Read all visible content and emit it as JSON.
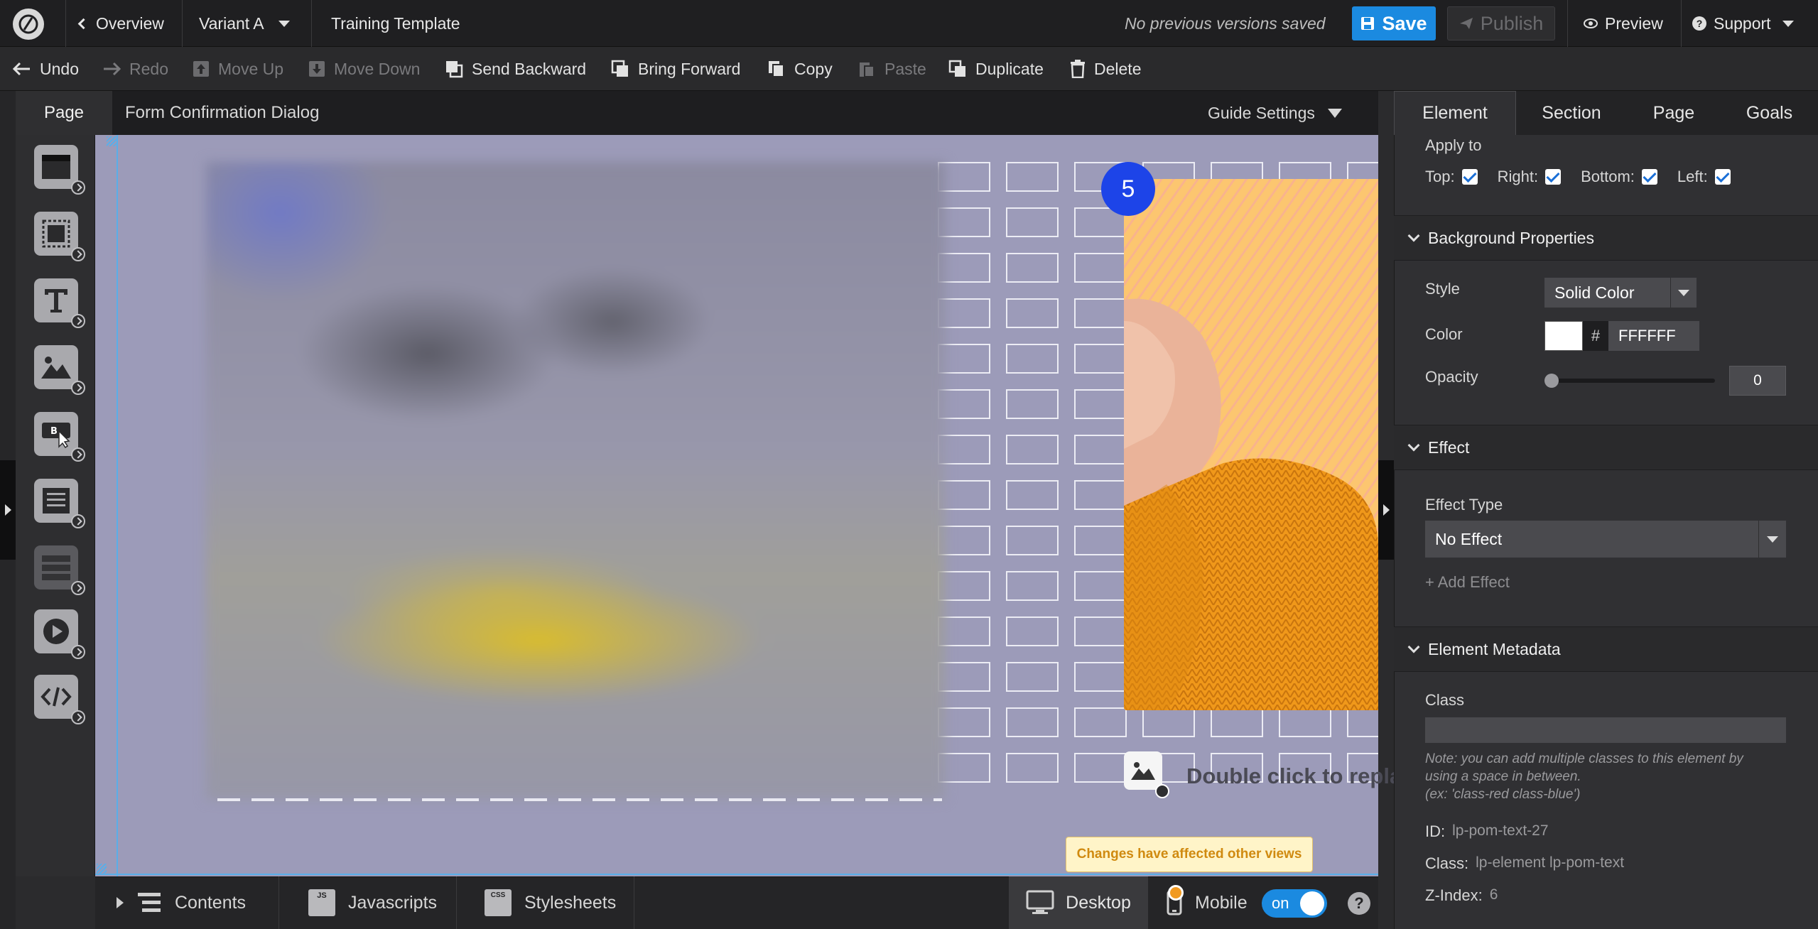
{
  "topbar": {
    "overview": "Overview",
    "variant": "Variant A",
    "template_name": "Training Template",
    "versions_status": "No previous versions saved",
    "save_label": "Save",
    "publish_label": "Publish",
    "preview_label": "Preview",
    "support_label": "Support"
  },
  "toolbar": {
    "undo": "Undo",
    "redo": "Redo",
    "move_up": "Move Up",
    "move_down": "Move Down",
    "send_backward": "Send Backward",
    "bring_forward": "Bring Forward",
    "copy": "Copy",
    "paste": "Paste",
    "duplicate": "Duplicate",
    "delete": "Delete"
  },
  "page_header": {
    "tab": "Page",
    "name": "Form Confirmation Dialog",
    "guide_settings": "Guide Settings"
  },
  "canvas": {
    "badge_number": "5",
    "replace_hint": "Double click to repla"
  },
  "right_panel": {
    "tabs": [
      "Element",
      "Section",
      "Page",
      "Goals"
    ],
    "apply_to": {
      "label": "Apply to",
      "top": "Top:",
      "right": "Right:",
      "bottom": "Bottom:",
      "left": "Left:"
    },
    "background": {
      "title": "Background Properties",
      "style_label": "Style",
      "style_value": "Solid Color",
      "color_label": "Color",
      "color_hash": "#",
      "color_value": "FFFFFF",
      "opacity_label": "Opacity",
      "opacity_value": "0"
    },
    "effect": {
      "title": "Effect",
      "type_label": "Effect Type",
      "type_value": "No Effect",
      "add_effect": "+ Add Effect"
    },
    "metadata": {
      "title": "Element Metadata",
      "class_label": "Class",
      "note_line1": "Note: you can add multiple classes to this element by",
      "note_line2": "using a space in between.",
      "note_line3": "(ex: 'class-red class-blue')",
      "id_label": "ID:",
      "id_value": "lp-pom-text-27",
      "class_info_label": "Class:",
      "class_info_value": "lp-element lp-pom-text",
      "zindex_label": "Z-Index:",
      "zindex_value": "6"
    }
  },
  "bottombar": {
    "contents": "Contents",
    "javascripts": "Javascripts",
    "stylesheets": "Stylesheets",
    "js_badge": "JS",
    "css_badge": "CSS",
    "desktop": "Desktop",
    "mobile": "Mobile",
    "toggle_label": "on",
    "help": "?",
    "notice": "Changes have affected other views"
  },
  "colors": {
    "accent": "#1b8ae0",
    "canvas_bg": "#9c9bb9",
    "badge": "#1d44e8",
    "notice_text": "#d08a10"
  }
}
